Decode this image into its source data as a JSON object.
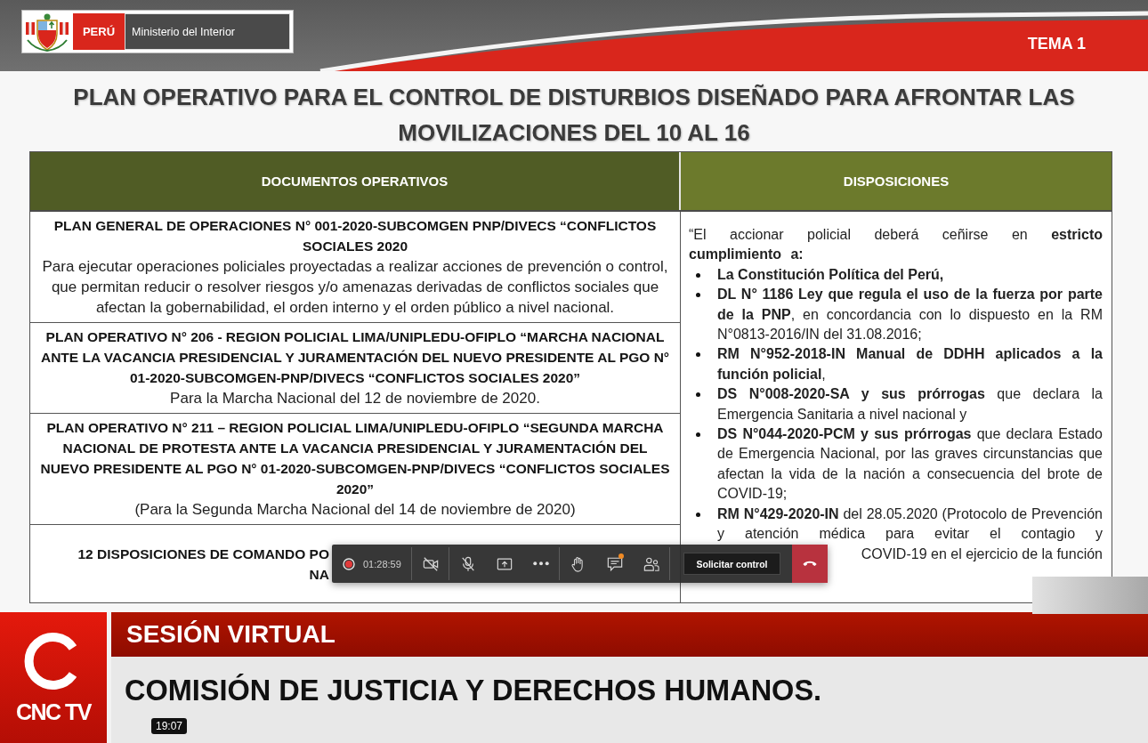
{
  "header": {
    "logo": {
      "country": "PERÚ",
      "ministry": "Ministerio del Interior"
    },
    "topic": "TEMA 1"
  },
  "slide": {
    "title": "PLAN OPERATIVO PARA EL CONTROL DE DISTURBIOS DISEÑADO PARA AFRONTAR LAS MOVILIZACIONES DEL 10 AL 16",
    "table": {
      "columns": [
        "DOCUMENTOS OPERATIVOS",
        "DISPOSICIONES"
      ],
      "documents": [
        {
          "kind": "document",
          "title": "PLAN GENERAL DE OPERACIONES N° 001-2020-SUBCOMGEN PNP/DIVECS “CONFLICTOS SOCIALES 2020",
          "description": "Para ejecutar operaciones policiales proyectadas a realizar acciones de prevención o control, que permitan reducir o resolver riesgos y/o amenazas derivadas de conflictos sociales que afectan la gobernabilidad, el orden interno y el orden público a nivel nacional."
        },
        {
          "kind": "document",
          "title": "PLAN OPERATIVO N° 206 - REGION POLICIAL LIMA/UNIPLEDU-OFIPLO “MARCHA NACIONAL ANTE LA VACANCIA PRESIDENCIAL Y JURAMENTACIÓN DEL NUEVO PRESIDENTE AL PGO N° 01-2020-SUBCOMGEN-PNP/DIVECS “CONFLICTOS SOCIALES 2020”",
          "description": "Para la Marcha Nacional del 12 de noviembre de 2020."
        },
        {
          "kind": "document",
          "title": "PLAN OPERATIVO N° 211 – REGION POLICIAL LIMA/UNIPLEDU-OFIPLO “SEGUNDA MARCHA NACIONAL DE PROTESTA ANTE LA VACANCIA PRESIDENCIAL Y JURAMENTACIÓN DEL NUEVO PRESIDENTE AL PGO N° 01-2020-SUBCOMGEN-PNP/DIVECS “CONFLICTOS SOCIALES 2020”",
          "description": "(Para la Segunda Marcha Nacional del 14 de noviembre de 2020)"
        },
        {
          "kind": "partly_covered",
          "visible_lines": [
            "12 DISPOSICIONES DE COMANDO PO",
            "NA"
          ]
        }
      ],
      "provisions": {
        "intro": "“El accionar policial deberá ceñirse en **estricto cumplimiento a:**",
        "items": [
          {
            "text": "**La Constitución Política del Perú,**"
          },
          {
            "text": "**DL N° 1186 Ley que regula el uso de la fuerza por parte de la PNP**, en concordancia con lo dispuesto en la RM N°0813-2016/IN del 31.08.2016;"
          },
          {
            "text": "**RM N°952-2018-IN Manual de DDHH aplicados a la función policial**,"
          },
          {
            "text": "**DS N°008-2020-SA y sus prórrogas** que declara la Emergencia Sanitaria a nivel nacional y"
          },
          {
            "text": "**DS N°044-2020-PCM y sus prórrogas** que declara Estado de Emergencia Nacional, por las graves circunstancias que afectan la vida de la nación a consecuencia del brote de COVID-19;"
          },
          {
            "text": "**RM N°429-2020-IN** del 28.05.2020 (Protocolo de Prevención y atención médica para evitar el contagio y",
            "visible_fragment": "COVID-19 en el ejercicio de la función"
          }
        ]
      }
    }
  },
  "meeting_toolbar": {
    "recording": true,
    "timer": "01:28:59",
    "button_groups": [
      [
        {
          "kind": "camera",
          "on": false
        }
      ],
      [
        {
          "kind": "mic",
          "on": false
        },
        {
          "kind": "share"
        },
        {
          "kind": "more"
        }
      ],
      [
        {
          "kind": "hand"
        },
        {
          "kind": "chat",
          "unread": true
        },
        {
          "kind": "participants"
        }
      ]
    ],
    "control_button": "Solicitar control"
  },
  "broadcast": {
    "channel": "CNC TV",
    "program_label": "SESIÓN VIRTUAL",
    "headline": "COMISIÓN DE JUSTICIA Y DERECHOS HUMANOS.",
    "timestamp": "19:07"
  }
}
